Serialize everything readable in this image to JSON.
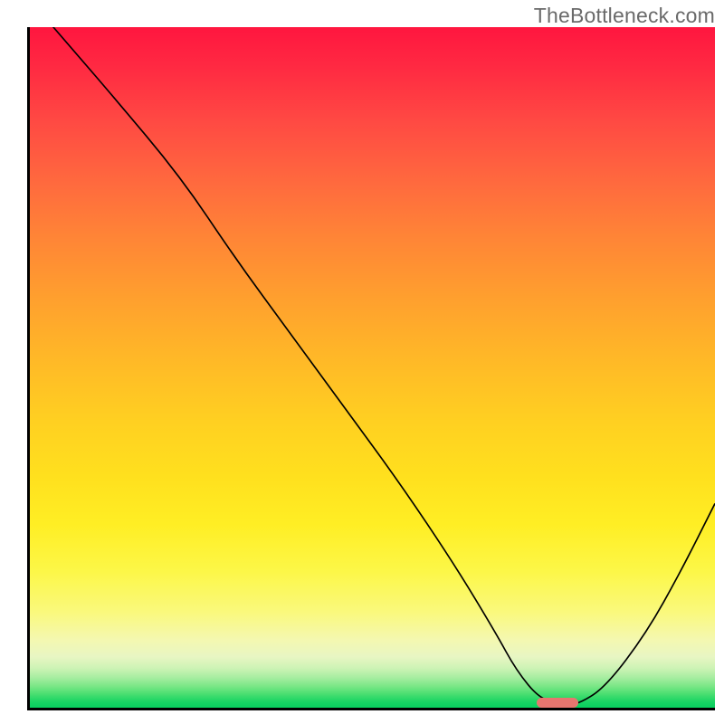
{
  "watermark": "TheBottleneck.com",
  "chart_data": {
    "type": "line",
    "title": "",
    "xlabel": "",
    "ylabel": "",
    "xlim": [
      0,
      100
    ],
    "ylim": [
      0,
      100
    ],
    "grid": false,
    "series": [
      {
        "name": "bottleneck-curve",
        "x": [
          0,
          6,
          12,
          22,
          30,
          38,
          46,
          54,
          62,
          68,
          71,
          74.5,
          78,
          80,
          84,
          90,
          95,
          100
        ],
        "values": [
          104,
          97,
          90,
          78,
          66,
          55,
          44,
          33,
          21,
          11,
          5.5,
          1.2,
          0.5,
          0.5,
          3,
          11,
          20,
          30
        ]
      }
    ],
    "annotations": [
      {
        "name": "optimal-marker",
        "x_start": 74,
        "x_end": 80,
        "y": 0.7
      }
    ],
    "background_scale": {
      "type": "vertical-gradient",
      "stops": [
        {
          "pos": 0.0,
          "color": "#ff163f"
        },
        {
          "pos": 0.4,
          "color": "#ffa02e"
        },
        {
          "pos": 0.73,
          "color": "#ffee24"
        },
        {
          "pos": 0.9,
          "color": "#f4f8b0"
        },
        {
          "pos": 1.0,
          "color": "#08cf5f"
        }
      ]
    }
  }
}
